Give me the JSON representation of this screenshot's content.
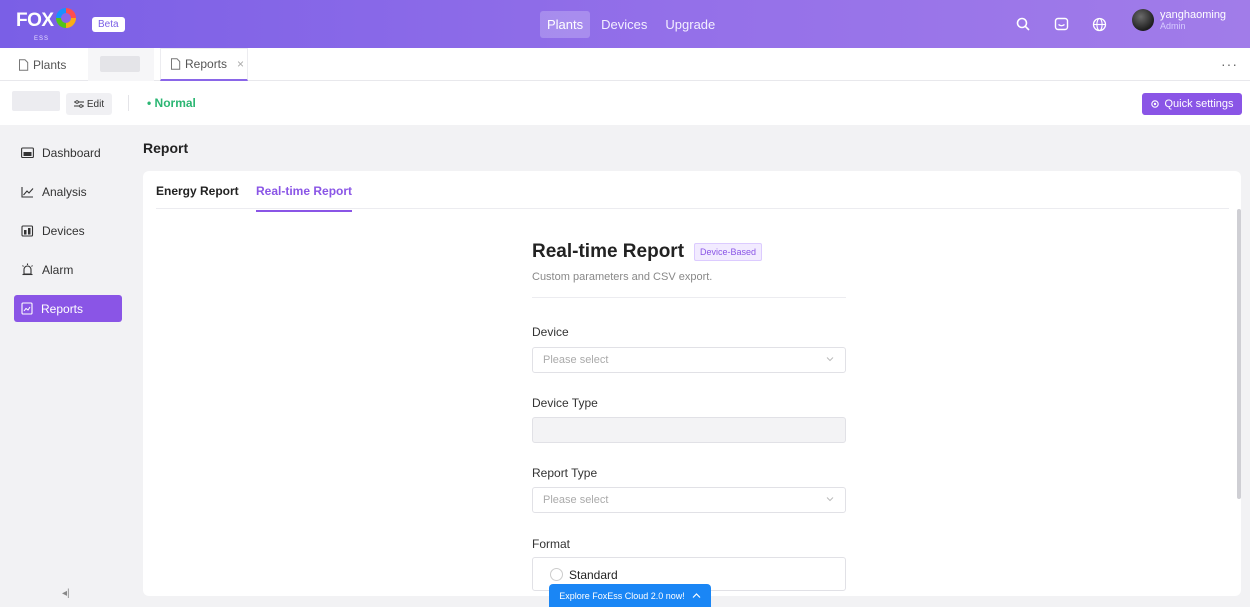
{
  "header": {
    "logo_text": "FOX",
    "logo_sub": "ESS",
    "beta": "Beta",
    "nav": [
      "Plants",
      "Devices",
      "Upgrade"
    ],
    "nav_active": "Plants",
    "user": {
      "name": "yanghaoming",
      "role": "Admin"
    },
    "icons": [
      "search-icon",
      "message-icon",
      "globe-icon"
    ]
  },
  "tabs": {
    "plants": "Plants",
    "reports": "Reports",
    "close": "×",
    "more": "···"
  },
  "status_bar": {
    "edit": "Edit",
    "status": "Normal",
    "quick_settings": "Quick settings"
  },
  "sidebar": {
    "items": [
      {
        "label": "Dashboard",
        "icon": "dashboard-icon"
      },
      {
        "label": "Analysis",
        "icon": "analysis-icon"
      },
      {
        "label": "Devices",
        "icon": "devices-icon"
      },
      {
        "label": "Alarm",
        "icon": "alarm-icon"
      },
      {
        "label": "Reports",
        "icon": "reports-icon",
        "active": true
      }
    ],
    "collapse": "◂|"
  },
  "main": {
    "page_title": "Report",
    "report_tabs": [
      "Energy Report",
      "Real-time Report"
    ],
    "active_tab": "Real-time Report",
    "form": {
      "title": "Real-time Report",
      "badge": "Device-Based",
      "subtitle": "Custom parameters and CSV export.",
      "device_label": "Device",
      "device_placeholder": "Please select",
      "device_type_label": "Device Type",
      "report_type_label": "Report Type",
      "report_type_placeholder": "Please select",
      "format_label": "Format",
      "format_option": "Standard"
    }
  },
  "banner": {
    "text": "Explore FoxEss Cloud 2.0 now!",
    "icon": "chevron-up-icon"
  },
  "colors": {
    "accent": "#8a55e6",
    "status_green": "#2bb673",
    "banner_blue": "#1a86f5"
  }
}
